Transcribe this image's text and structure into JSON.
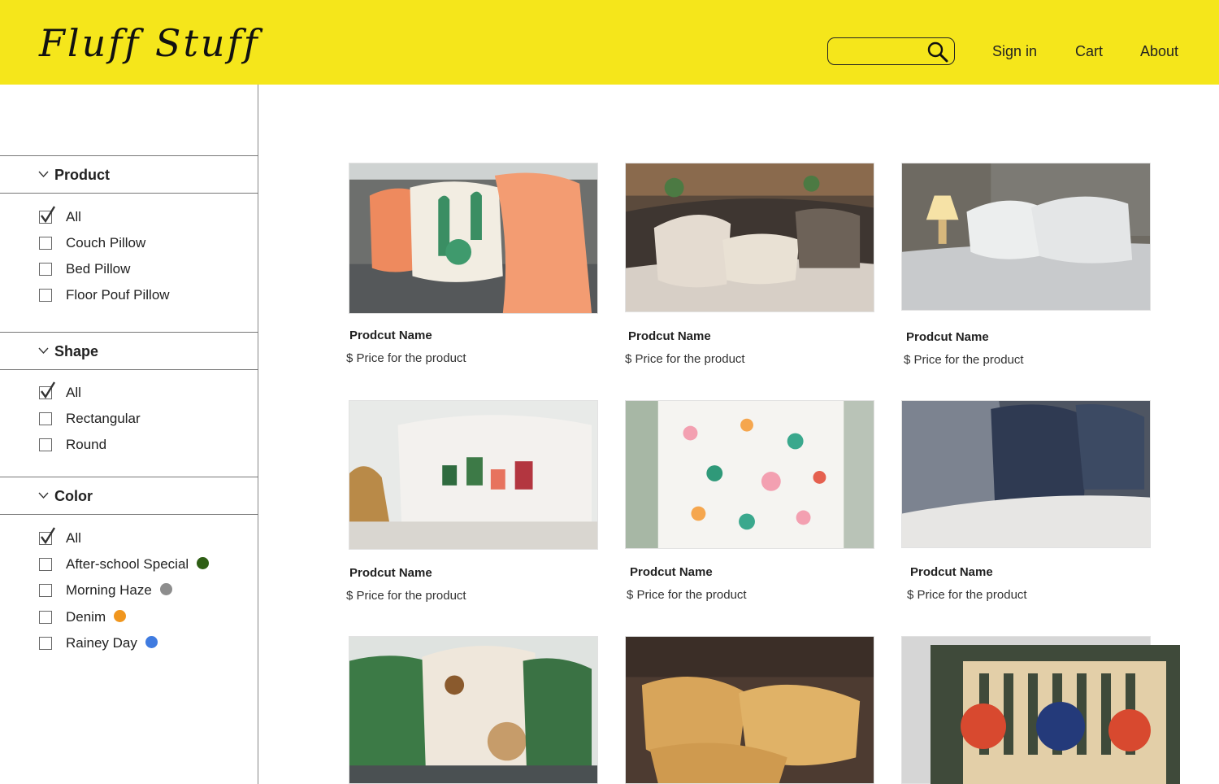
{
  "header": {
    "logo": "Fluff Stuff",
    "search_placeholder": "",
    "search_icon": "search-icon",
    "nav": {
      "sign_in": "Sign in",
      "cart": "Cart",
      "about": "About"
    },
    "background_color": "#f5e61b"
  },
  "sidebar": {
    "sections": [
      {
        "title": "Product",
        "options": [
          {
            "label": "All",
            "checked": true
          },
          {
            "label": "Couch Pillow",
            "checked": false
          },
          {
            "label": "Bed Pillow",
            "checked": false
          },
          {
            "label": "Floor Pouf Pillow",
            "checked": false
          }
        ]
      },
      {
        "title": "Shape",
        "options": [
          {
            "label": "All",
            "checked": true
          },
          {
            "label": "Rectangular",
            "checked": false
          },
          {
            "label": "Round",
            "checked": false
          }
        ]
      },
      {
        "title": "Color",
        "options": [
          {
            "label": "All",
            "checked": true
          },
          {
            "label": "After-school Special",
            "checked": false,
            "swatch": "#2e5e14"
          },
          {
            "label": "Morning Haze",
            "checked": false,
            "swatch": "#8d8d8d"
          },
          {
            "label": "Denim",
            "checked": false,
            "swatch": "#f0961e"
          },
          {
            "label": "Rainey Day",
            "checked": false,
            "swatch": "#3f7be0"
          }
        ]
      }
    ]
  },
  "products": [
    {
      "name": "Prodcut Name",
      "price": "$ Price for the product",
      "image": "cactus-pillow-couch-photo"
    },
    {
      "name": "Prodcut Name",
      "price": "$ Price for the product",
      "image": "cream-pillows-bed-photo"
    },
    {
      "name": "Prodcut Name",
      "price": "$ Price for the product",
      "image": "white-bed-pillows-photo"
    },
    {
      "name": "Prodcut Name",
      "price": "$ Price for the product",
      "image": "embroidered-cactus-pillow-photo"
    },
    {
      "name": "Prodcut Name",
      "price": "$ Price for the product",
      "image": "flamingo-pattern-pillow-photo"
    },
    {
      "name": "Prodcut Name",
      "price": "$ Price for the product",
      "image": "navy-pattern-pillows-photo"
    },
    {
      "name": "",
      "price": "",
      "image": "pinecone-green-pillows-photo"
    },
    {
      "name": "",
      "price": "",
      "image": "mustard-pillows-photo"
    },
    {
      "name": "",
      "price": "",
      "image": "garden-bench-pillows-photo"
    }
  ]
}
